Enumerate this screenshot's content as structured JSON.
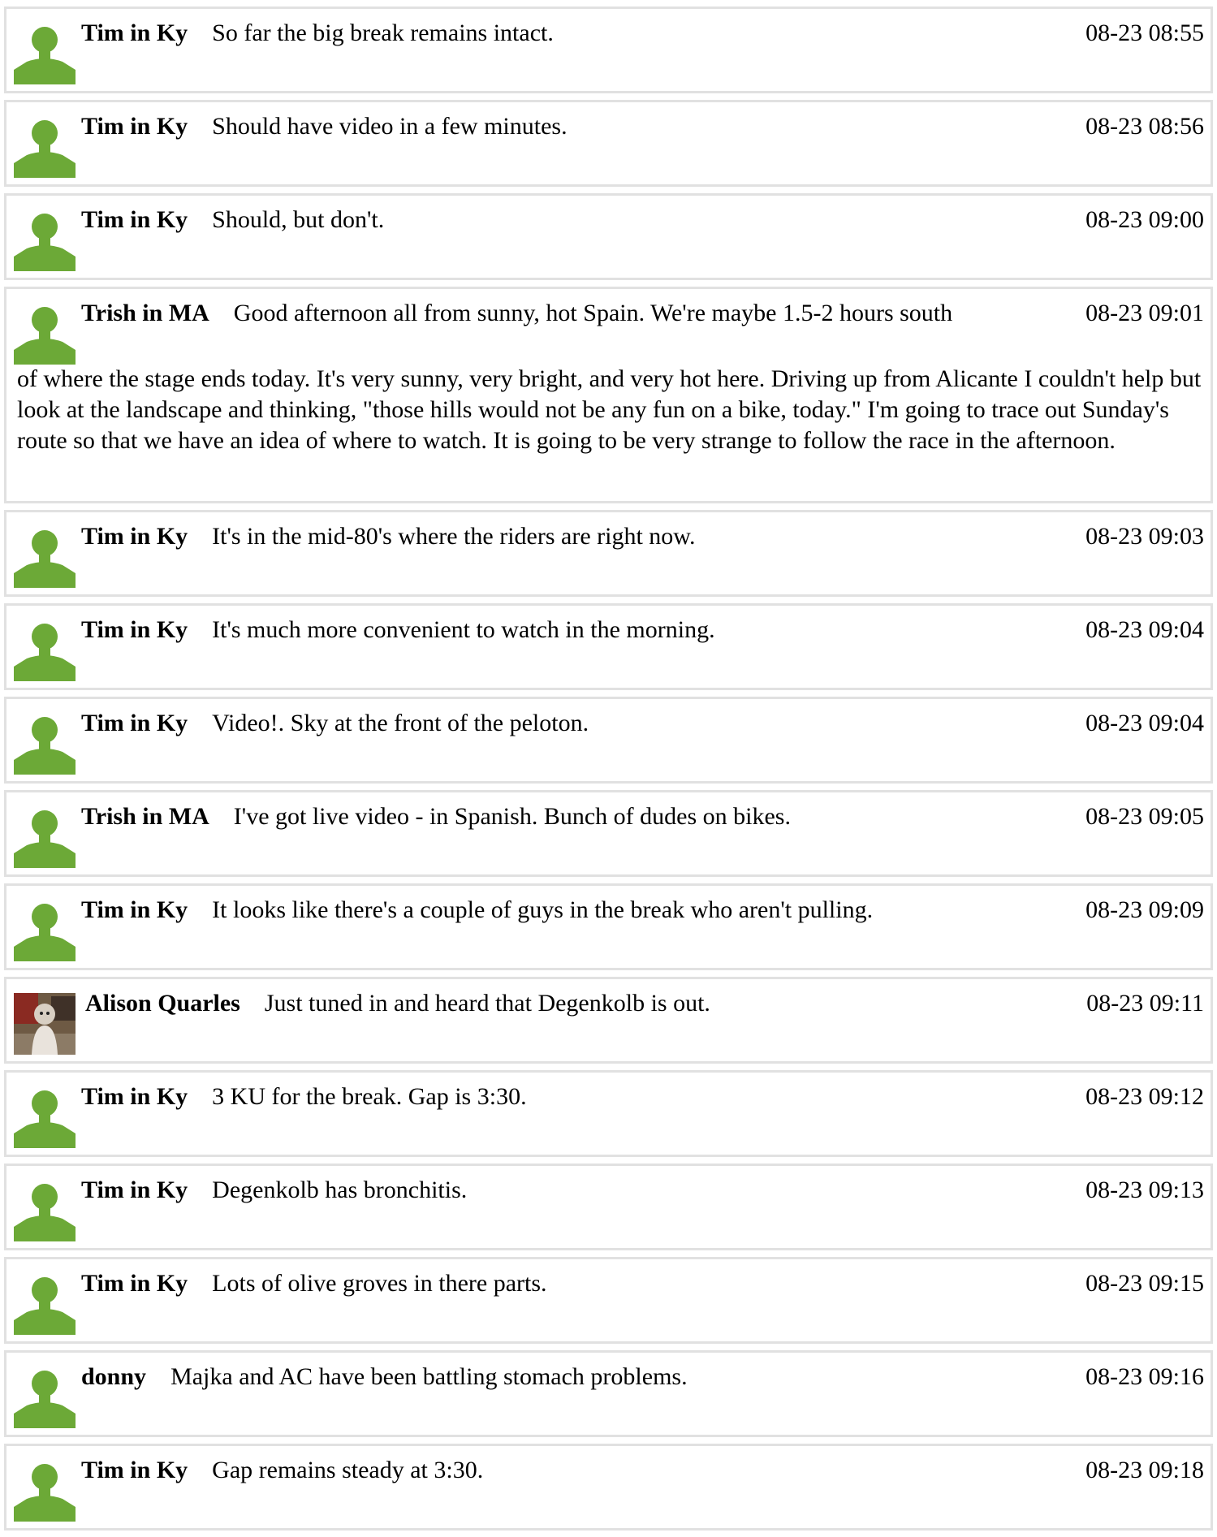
{
  "colors": {
    "avatar_green": "#6ca937",
    "border": "#e1e1e1"
  },
  "posts": [
    {
      "author": "Tim in Ky",
      "message": "So far the big break remains intact.",
      "time": "08-23 08:55",
      "avatar": "default-user-icon"
    },
    {
      "author": "Tim in Ky",
      "message": "Should have video in a few minutes.",
      "time": "08-23 08:56",
      "avatar": "default-user-icon"
    },
    {
      "author": "Tim in Ky",
      "message": "Should, but don't.",
      "time": "08-23 09:00",
      "avatar": "default-user-icon"
    },
    {
      "author": "Trish in MA",
      "message": "Good afternoon all from sunny, hot Spain. We're maybe 1.5-2 hours south",
      "message_cont": "of where the stage ends today. It's very sunny, very bright, and very hot here. Driving up from Alicante I couldn't help but look at the landscape and thinking, \"those hills would not be any fun on a bike, today.\" I'm going to trace out Sunday's route so that we have an idea of where to watch. It is going to be very strange to follow the race in the afternoon.",
      "time": "08-23 09:01",
      "avatar": "default-user-icon"
    },
    {
      "author": "Tim in Ky",
      "message": "It's in the mid-80's where the riders are right now.",
      "time": "08-23 09:03",
      "avatar": "default-user-icon"
    },
    {
      "author": "Tim in Ky",
      "message": "It's much more convenient to watch in the morning.",
      "time": "08-23 09:04",
      "avatar": "default-user-icon"
    },
    {
      "author": "Tim in Ky",
      "message": "Video!. Sky at the front of the peloton.",
      "time": "08-23 09:04",
      "avatar": "default-user-icon"
    },
    {
      "author": "Trish in MA",
      "message": "I've got live video - in Spanish. Bunch of dudes on bikes.",
      "time": "08-23 09:05",
      "avatar": "default-user-icon"
    },
    {
      "author": "Tim in Ky",
      "message": "It looks like there's a couple of guys in the break who aren't pulling.",
      "time": "08-23 09:09",
      "avatar": "default-user-icon"
    },
    {
      "author": "Alison Quarles",
      "message": "Just tuned in and heard that Degenkolb is out.",
      "time": "08-23 09:11",
      "avatar": "user-photo"
    },
    {
      "author": "Tim in Ky",
      "message": "3 KU for the break. Gap is 3:30.",
      "time": "08-23 09:12",
      "avatar": "default-user-icon"
    },
    {
      "author": "Tim in Ky",
      "message": "Degenkolb has bronchitis.",
      "time": "08-23 09:13",
      "avatar": "default-user-icon"
    },
    {
      "author": "Tim in Ky",
      "message": "Lots of olive groves in there parts.",
      "time": "08-23 09:15",
      "avatar": "default-user-icon"
    },
    {
      "author": "donny",
      "message": "Majka and AC have been battling stomach problems.",
      "time": "08-23 09:16",
      "avatar": "default-user-icon"
    },
    {
      "author": "Tim in Ky",
      "message": "Gap remains steady at 3:30.",
      "time": "08-23 09:18",
      "avatar": "default-user-icon"
    }
  ]
}
